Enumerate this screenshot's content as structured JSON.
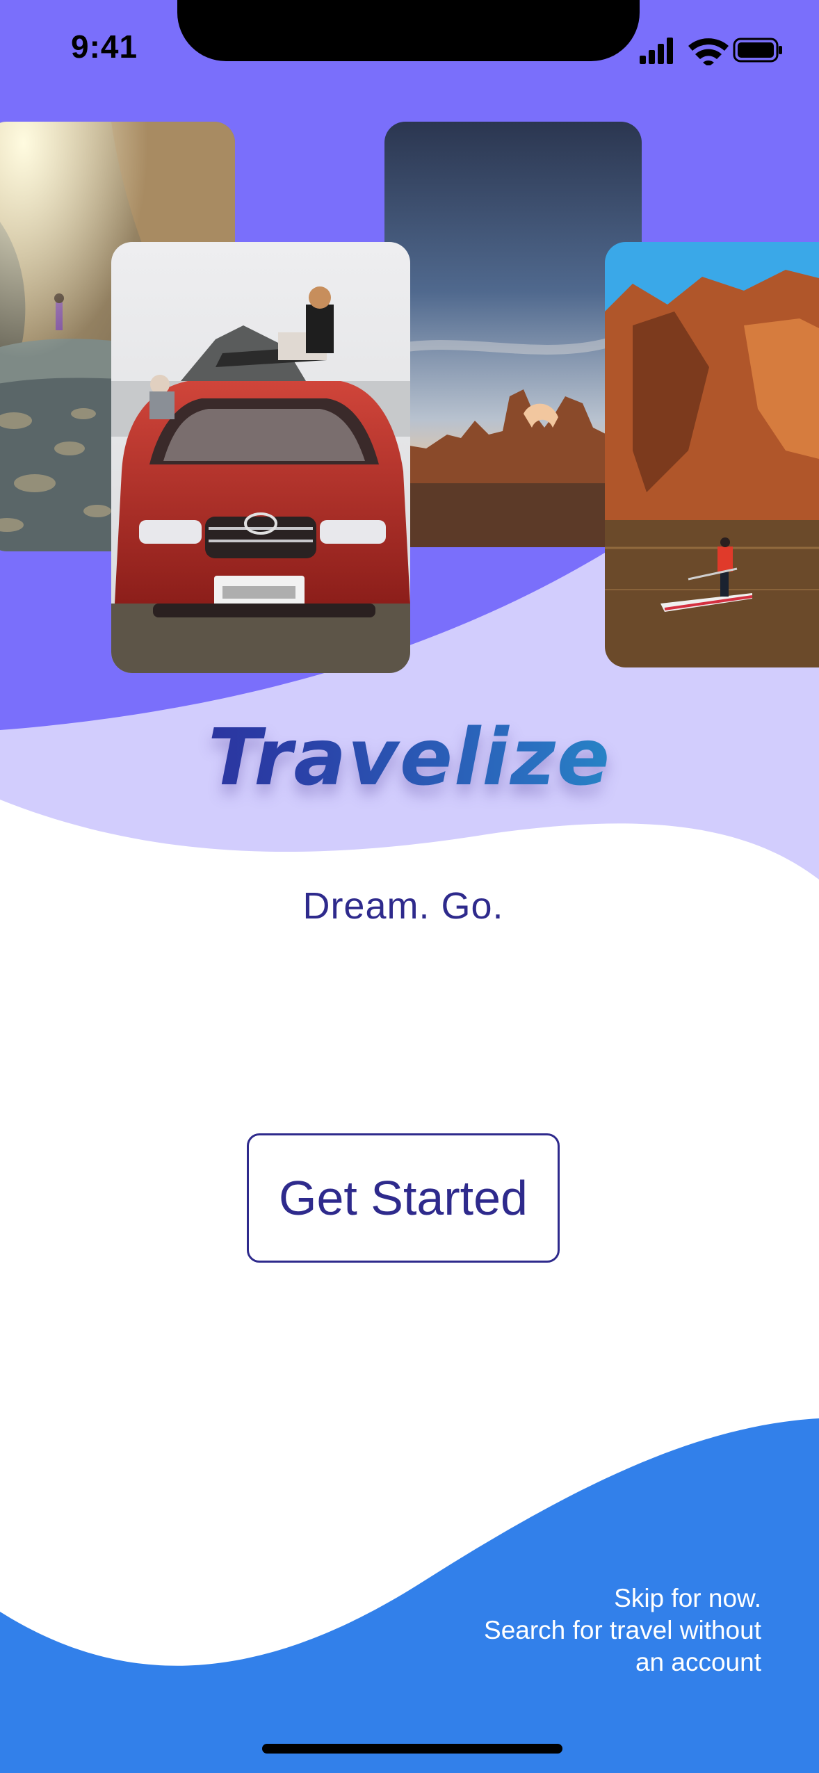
{
  "status_bar": {
    "time": "9:41"
  },
  "logo": {
    "text": "Travelize"
  },
  "tagline": "Dream. Go.",
  "cta": {
    "label": "Get Started"
  },
  "skip": {
    "text": "Skip for now.\nSearch for travel  without\nan account"
  },
  "colors": {
    "header_purple": "#7a6ffb",
    "lavender": "#d2cdfd",
    "bottom_blue": "#3280ea",
    "text_navy": "#2e2a8c"
  },
  "icons": [
    "signal-icon",
    "wifi-icon",
    "battery-icon"
  ],
  "photos": [
    "canyon-hiker-photo",
    "red-car-roof-rack-photo",
    "desert-arch-sunset-photo",
    "paddleboard-cliffs-photo"
  ]
}
